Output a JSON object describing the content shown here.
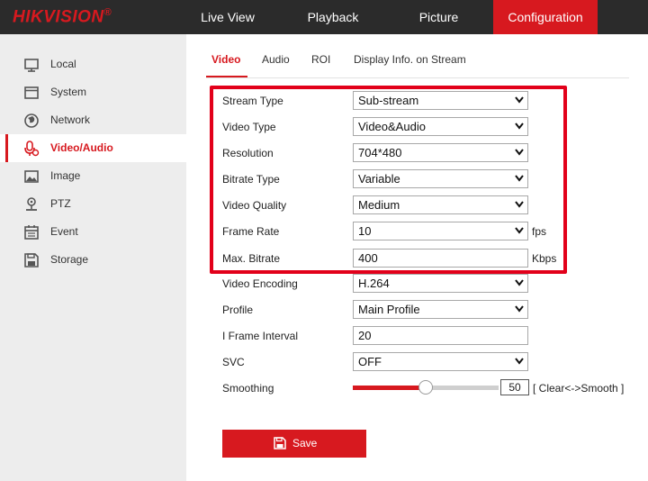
{
  "brand": {
    "logo_text": "HIKVISION",
    "reg_mark": "®",
    "accent_color": "#d7191f"
  },
  "topnav": {
    "items": [
      {
        "label": "Live View"
      },
      {
        "label": "Playback"
      },
      {
        "label": "Picture"
      },
      {
        "label": "Configuration",
        "active": true
      }
    ]
  },
  "sidebar": {
    "items": [
      {
        "label": "Local",
        "icon": "monitor-icon"
      },
      {
        "label": "System",
        "icon": "window-icon"
      },
      {
        "label": "Network",
        "icon": "globe-icon"
      },
      {
        "label": "Video/Audio",
        "icon": "microphone-icon",
        "active": true
      },
      {
        "label": "Image",
        "icon": "image-icon"
      },
      {
        "label": "PTZ",
        "icon": "ptz-icon"
      },
      {
        "label": "Event",
        "icon": "calendar-icon"
      },
      {
        "label": "Storage",
        "icon": "floppy-icon"
      }
    ]
  },
  "tabs": [
    {
      "label": "Video",
      "active": true
    },
    {
      "label": "Audio"
    },
    {
      "label": "ROI"
    },
    {
      "label": "Display Info. on Stream"
    }
  ],
  "form": {
    "stream_type": {
      "label": "Stream Type",
      "value": "Sub-stream"
    },
    "video_type": {
      "label": "Video Type",
      "value": "Video&Audio"
    },
    "resolution": {
      "label": "Resolution",
      "value": "704*480"
    },
    "bitrate_type": {
      "label": "Bitrate Type",
      "value": "Variable"
    },
    "video_quality": {
      "label": "Video Quality",
      "value": "Medium"
    },
    "frame_rate": {
      "label": "Frame Rate",
      "value": "10",
      "unit": "fps"
    },
    "max_bitrate": {
      "label": "Max. Bitrate",
      "value": "400",
      "unit": "Kbps"
    },
    "video_encoding": {
      "label": "Video Encoding",
      "value": "H.264"
    },
    "profile": {
      "label": "Profile",
      "value": "Main Profile"
    },
    "i_frame_interval": {
      "label": "I Frame Interval",
      "value": "20"
    },
    "svc": {
      "label": "SVC",
      "value": "OFF"
    },
    "smoothing": {
      "label": "Smoothing",
      "value": "50",
      "level": 0.5,
      "hint": "[ Clear<->Smooth ]"
    }
  },
  "save_label": "Save"
}
